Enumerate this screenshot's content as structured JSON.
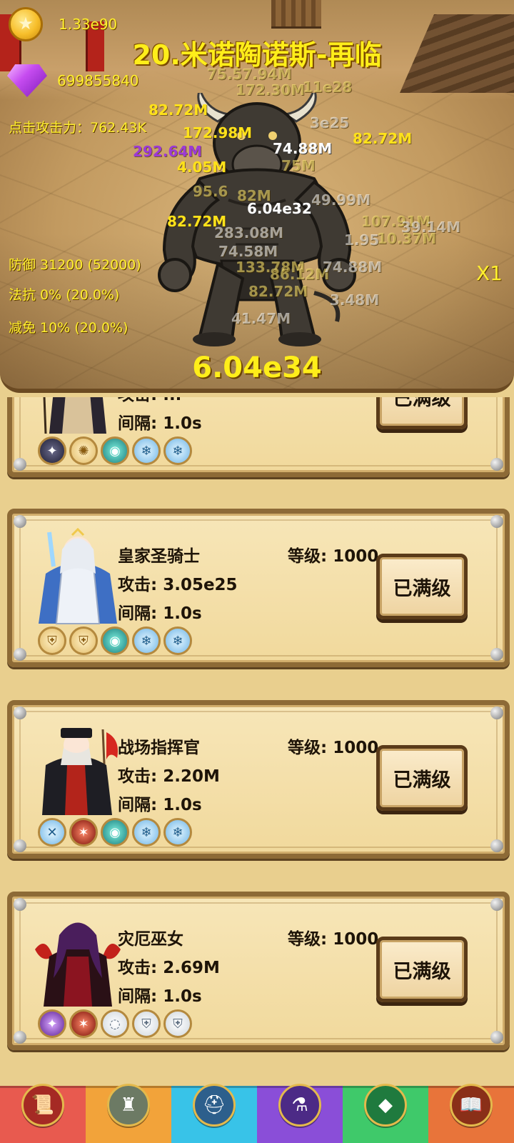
{
  "resources": {
    "gold": "1.33e90",
    "gems": "699855840"
  },
  "stage": {
    "title": "20.米诺陶诺斯-再临",
    "boss_hp": "6.04e34",
    "speed": "X1"
  },
  "player_stats": {
    "click_attack": "点击攻击力：762.43K",
    "defense": "防御 31200 (52000)",
    "magic_resist": "法抗 0% (20.0%)",
    "damage_reduction": "减免 10% (20.0%)"
  },
  "damage_numbers": {
    "d01": "75.57.94M",
    "d02": "172.30M",
    "d03": "11e28",
    "d04": "82.72M",
    "d05": "3e25",
    "d06": "172.98M",
    "d07": "82.72M",
    "d08": "292.64M",
    "d09": "74.88M",
    "d10": "4.05M",
    "d11": "75M",
    "d12": "95.6",
    "d13": "82M",
    "d14": "49.99M",
    "d15": "6.04e32",
    "d16": "82.72M",
    "d17": "107.91M",
    "d18": "39.14M",
    "d19": "283.08M",
    "d20": "10.37M",
    "d21": "1.95",
    "d22": "74.58M",
    "d23": "133.78M",
    "d24": "86.12M",
    "d25": "74.88M",
    "d26": "82.72M",
    "d27": "3.48M",
    "d28": "41.47M"
  },
  "labels": {
    "level_prefix": "等级: ",
    "atk_prefix": "攻击: ",
    "interval_prefix": "间隔: "
  },
  "heroes": [
    {
      "name": "",
      "level": "",
      "attack": "攻击: ...",
      "interval": "间隔: 1.0s",
      "button": "已满级",
      "skills": [
        "dark-orb",
        "gold-burst",
        "teal-eye",
        "ice-wing",
        "ice-wing"
      ]
    },
    {
      "name": "皇家圣骑士",
      "level": "等级: 1000",
      "attack": "攻击: 3.05e25",
      "interval": "间隔: 1.0s",
      "button": "已满级",
      "skills": [
        "gold-shield",
        "gold-shield",
        "teal-eye",
        "ice-wing",
        "ice-wing"
      ]
    },
    {
      "name": "战场指挥官",
      "level": "等级: 1000",
      "attack": "攻击: 2.20M",
      "interval": "间隔: 1.0s",
      "button": "已满级",
      "skills": [
        "ice-cross",
        "red-claw",
        "teal-eye",
        "ice-wing",
        "ice-wing"
      ]
    },
    {
      "name": "灾厄巫女",
      "level": "等级: 1000",
      "attack": "攻击: 2.69M",
      "interval": "间隔: 1.0s",
      "button": "已满级",
      "skills": [
        "purple-rune",
        "red-claw",
        "white-ring",
        "white-shield",
        "white-shield"
      ]
    }
  ],
  "nav": [
    {
      "icon": "scroll-icon",
      "color": "#e85a4f"
    },
    {
      "icon": "castle-icon",
      "color": "#f2a33a"
    },
    {
      "icon": "helmet-icon",
      "color": "#38c3e8"
    },
    {
      "icon": "potion-icon",
      "color": "#8a4ed8"
    },
    {
      "icon": "treasure-icon",
      "color": "#3fc96a"
    },
    {
      "icon": "book-icon",
      "color": "#e8743a"
    }
  ]
}
